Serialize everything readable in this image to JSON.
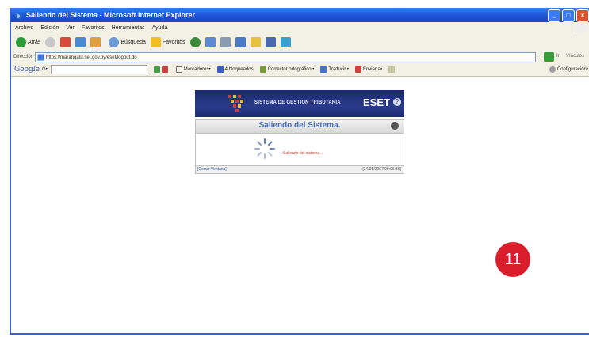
{
  "window": {
    "title": "Saliendo del Sistema - Microsoft Internet Explorer",
    "buttons": {
      "minimize": "_",
      "maximize": "□",
      "close": "×"
    }
  },
  "menu": {
    "items": [
      "Archivo",
      "Edición",
      "Ver",
      "Favoritos",
      "Herramientas",
      "Ayuda"
    ]
  },
  "toolbar": {
    "back_label": "Atrás",
    "search_label": "Búsqueda",
    "favorites_label": "Favoritos"
  },
  "address": {
    "label": "Dirección",
    "url": "https://marangatu.set.gov.py/eset/logout.do",
    "go_label": "Ir",
    "links_label": "Vínculos"
  },
  "google_toolbar": {
    "logo": "Google",
    "search_prefix": "G•",
    "bookmarks_label": "Marcadores•",
    "blocked_label": "4 bloqueados",
    "spellcheck_label": "Corrector ortográfico •",
    "translate_label": "Traducir •",
    "send_label": "Enviar a•",
    "settings_label": "Configuración•"
  },
  "eset": {
    "subtitle": "SISTEMA DE GESTION TRIBUTARIA",
    "logo": "ESET",
    "help_glyph": "?",
    "header_title": "Saliendo del Sistema.",
    "message": "Saliendo del sistema...",
    "footer_left": "[Cerrar Ventana]",
    "footer_right": "[24/05/2007 09:06:36]"
  },
  "step_badge": "11"
}
